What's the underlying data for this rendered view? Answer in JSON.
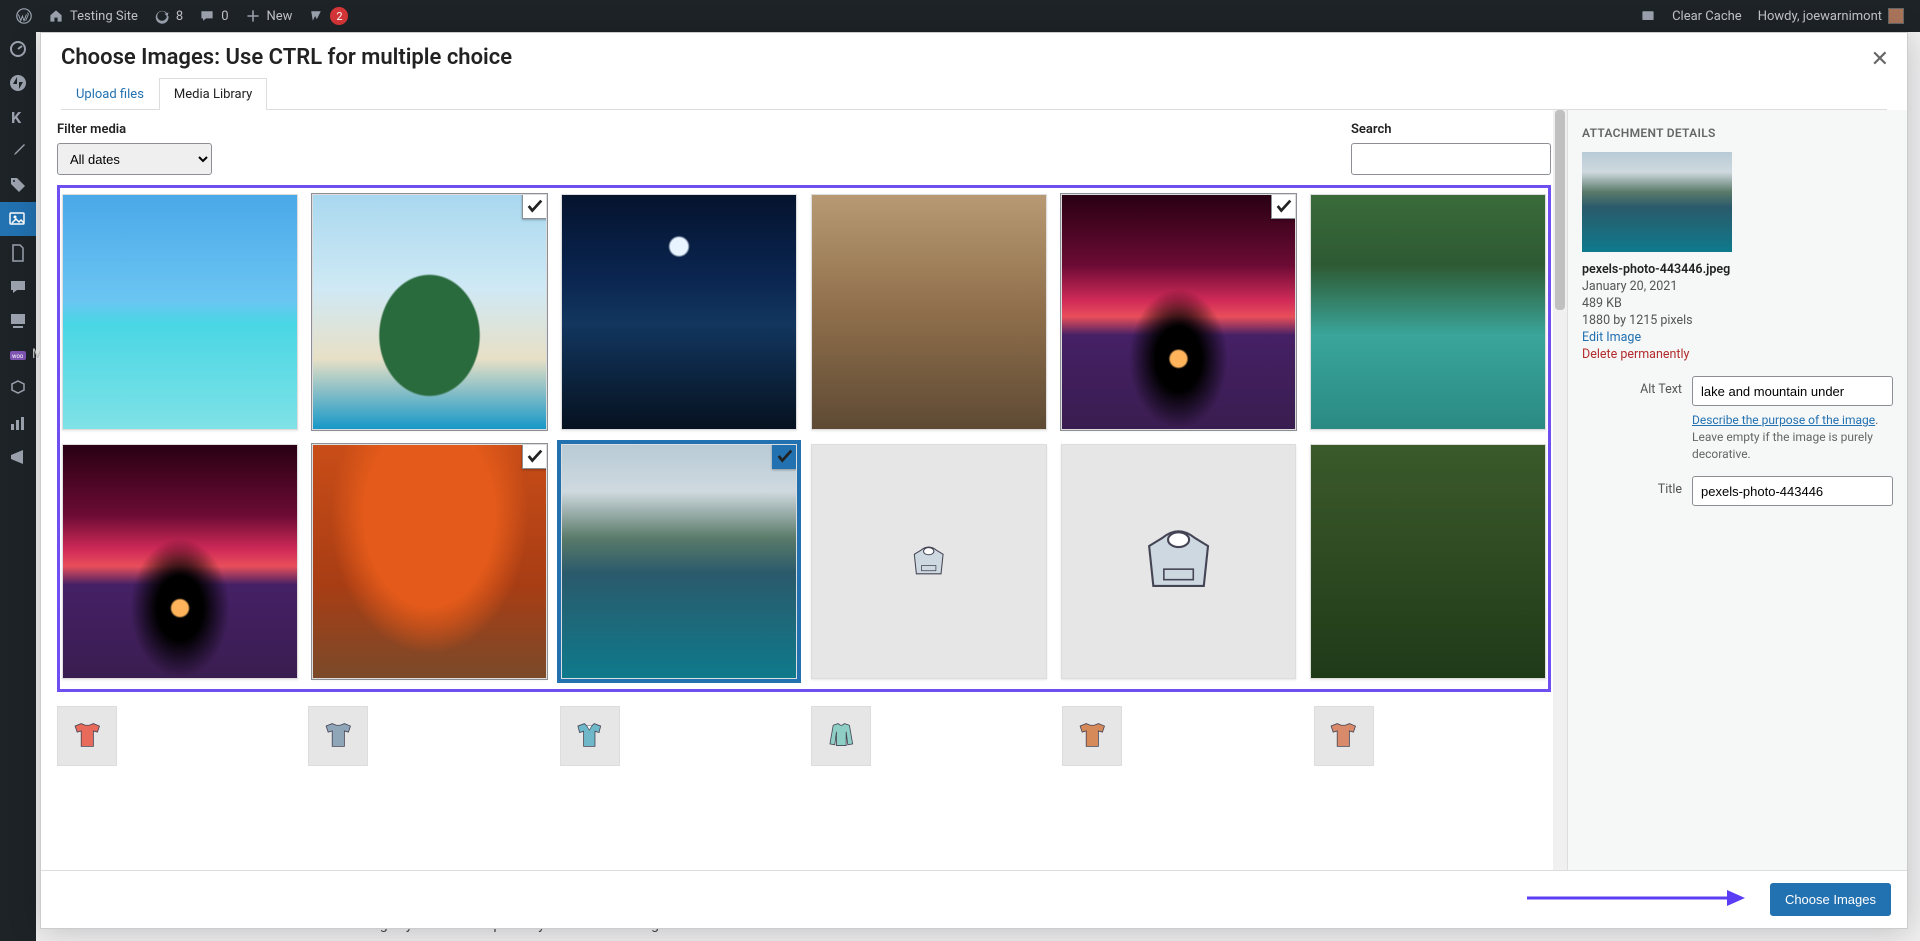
{
  "adminbar": {
    "site": "Testing Site",
    "updates": "8",
    "comments": "0",
    "new": "New",
    "yoast_badge": "2",
    "clear_cache": "Clear Cache",
    "howdy": "Howdy, joewarnimont"
  },
  "bg_page": {
    "sidebar_marketing": "Marketing",
    "step_text": "Select the featured images you want to replace by the selected image."
  },
  "modal": {
    "title": "Choose Images: Use CTRL for multiple choice",
    "tabs": {
      "upload": "Upload files",
      "library": "Media Library"
    },
    "filter_label": "Filter media",
    "filter_value": "All dates",
    "search_label": "Search",
    "footer_button": "Choose Images",
    "media": [
      {
        "name": "beach",
        "checked": false,
        "selected": false,
        "cls": "img-beach"
      },
      {
        "name": "tropical-island",
        "checked": true,
        "selected": false,
        "cls": "img-tropics"
      },
      {
        "name": "moonlit-dock",
        "checked": false,
        "selected": false,
        "cls": "img-dock"
      },
      {
        "name": "desert-canyon",
        "checked": false,
        "selected": false,
        "cls": "img-desert"
      },
      {
        "name": "tree-sunset",
        "checked": true,
        "selected": false,
        "cls": "img-sunset1"
      },
      {
        "name": "forest-river",
        "checked": false,
        "selected": false,
        "cls": "img-forestriver"
      },
      {
        "name": "tree-sunset-2",
        "checked": false,
        "selected": false,
        "cls": "img-sunset2"
      },
      {
        "name": "autumn-path",
        "checked": true,
        "selected": false,
        "cls": "img-autumn"
      },
      {
        "name": "lake-mountain",
        "checked": true,
        "selected": true,
        "cls": "img-lakemtn"
      },
      {
        "name": "hoodie-small",
        "checked": false,
        "selected": false,
        "cls": "img-blank",
        "product": "hoodie-sm"
      },
      {
        "name": "hoodie-logo",
        "checked": false,
        "selected": false,
        "cls": "img-hoodie",
        "product": "hoodie"
      },
      {
        "name": "pine-forest",
        "checked": false,
        "selected": false,
        "cls": "img-pines"
      }
    ],
    "more_media": [
      {
        "product": "tshirt",
        "color": "#e76a5a"
      },
      {
        "product": "tshirt",
        "color": "#8fa5b8"
      },
      {
        "product": "polo",
        "color": "#6fb8c9"
      },
      {
        "product": "long",
        "color": "#8fcec4"
      },
      {
        "product": "tshirt",
        "color": "#d68a5a"
      },
      {
        "product": "tshirt",
        "color": "#d88a6a"
      }
    ]
  },
  "details": {
    "heading": "ATTACHMENT DETAILS",
    "filename": "pexels-photo-443446.jpeg",
    "date": "January 20, 2021",
    "size": "489 KB",
    "dims": "1880 by 1215 pixels",
    "edit": "Edit Image",
    "delete": "Delete permanently",
    "alt_label": "Alt Text",
    "alt_value": "lake and mountain under",
    "alt_help_link": "Describe the purpose of the image",
    "alt_help_rest": ". Leave empty if the image is purely decorative.",
    "title_label": "Title",
    "title_value": "pexels-photo-443446"
  }
}
